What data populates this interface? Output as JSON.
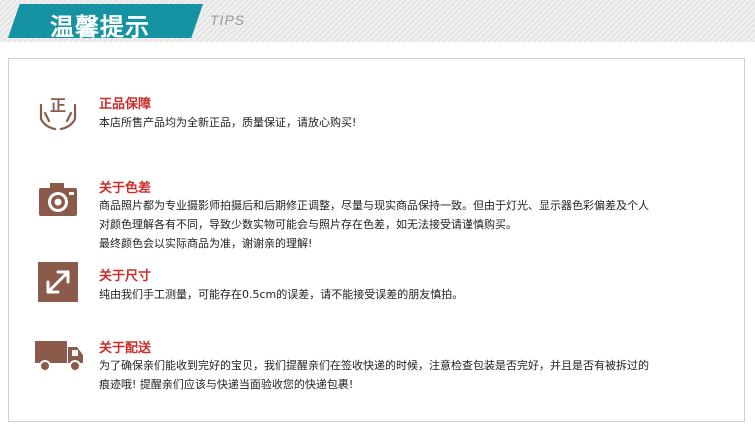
{
  "header": {
    "title": "温馨提示",
    "subtitle": "TIPS"
  },
  "colors": {
    "accent_teal": "#1593a2",
    "title_red": "#c9302c",
    "icon_brown": "#8b5a4a"
  },
  "sections": [
    {
      "icon": "zheng-hands-icon",
      "title": "正品保障",
      "lines": [
        "本店所售产品均为全新正品，质量保证，请放心购买!"
      ]
    },
    {
      "icon": "camera-icon",
      "title": "关于色差",
      "lines": [
        "商品照片都为专业摄影师拍摄后和后期修正调整，尽量与现实商品保持一致。但由于灯光、显示器色彩偏差及个人",
        "对颜色理解各有不同，导致少数实物可能会与照片存在色差，如无法接受请谨慎购买。",
        "最终颜色会以实际商品为准，谢谢亲的理解!"
      ]
    },
    {
      "icon": "resize-arrow-icon",
      "title": "关于尺寸",
      "lines": [
        "纯由我们手工测量，可能存在0.5cm的误差，请不能接受误差的朋友慎拍。"
      ]
    },
    {
      "icon": "truck-icon",
      "title": "关于配送",
      "lines": [
        "为了确保亲们能收到完好的宝贝，我们提醒亲们在签收快递的时候，注意检查包装是否完好，并且是否有被拆过的",
        "痕迹哦! 提醒亲们应该与快递当面验收您的快递包裹!"
      ]
    }
  ]
}
